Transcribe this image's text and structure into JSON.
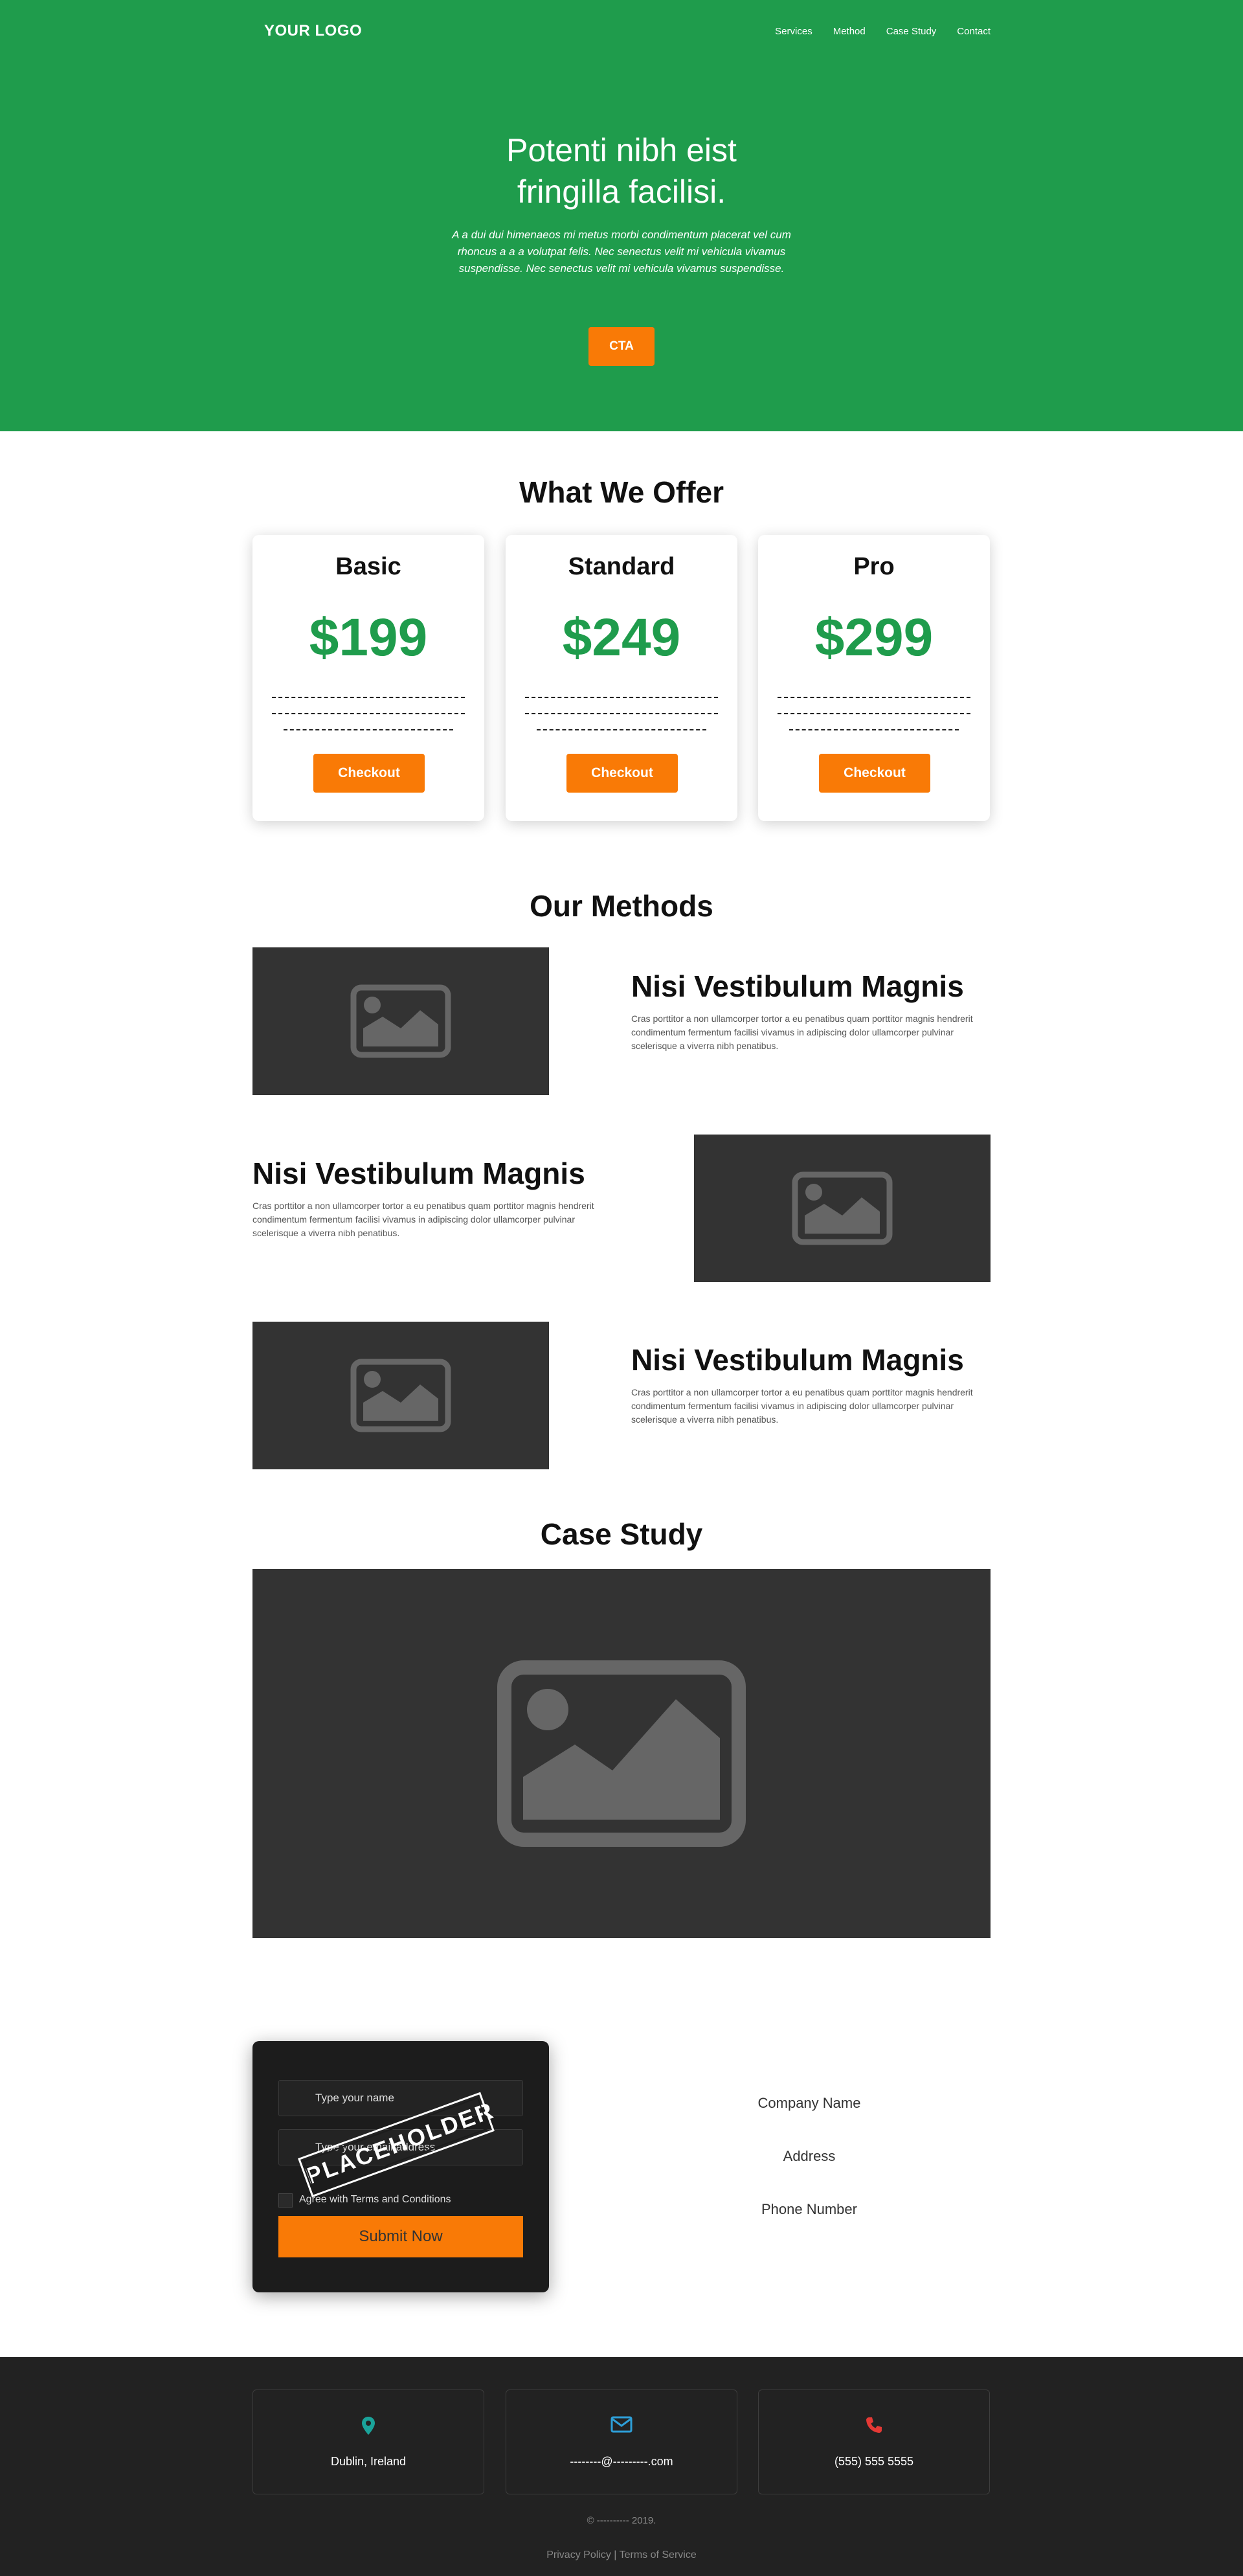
{
  "nav": {
    "logo": "YOUR LOGO",
    "links": [
      "Services",
      "Method",
      "Case Study",
      "Contact"
    ]
  },
  "hero": {
    "title_line1": "Potenti nibh eist",
    "title_line2": "fringilla facilisi.",
    "subtitle": "A a dui dui himenaeos mi metus morbi condimentum placerat vel cum rhoncus a a a volutpat felis. Nec senectus velit mi vehicula vivamus suspendisse. Nec senectus velit mi vehicula vivamus suspendisse.",
    "cta_label": "CTA"
  },
  "offer": {
    "title": "What We Offer",
    "plans": [
      {
        "name": "Basic",
        "price": "$199",
        "button": "Checkout"
      },
      {
        "name": "Standard",
        "price": "$249",
        "button": "Checkout"
      },
      {
        "name": "Pro",
        "price": "$299",
        "button": "Checkout"
      }
    ]
  },
  "methods": {
    "title": "Our Methods",
    "items": [
      {
        "title": "Nisi Vestibulum Magnis",
        "text": "Cras porttitor a non ullamcorper tortor a eu penatibus quam porttitor magnis hendrerit condimentum fermentum facilisi vivamus in adipiscing dolor ullamcorper pulvinar scelerisque a viverra nibh penatibus."
      },
      {
        "title": "Nisi Vestibulum Magnis",
        "text": "Cras porttitor a non ullamcorper tortor a eu penatibus quam porttitor magnis hendrerit condimentum fermentum facilisi vivamus in adipiscing dolor ullamcorper pulvinar scelerisque a viverra nibh penatibus."
      },
      {
        "title": "Nisi Vestibulum Magnis",
        "text": "Cras porttitor a non ullamcorper tortor a eu penatibus quam porttitor magnis hendrerit condimentum fermentum facilisi vivamus in adipiscing dolor ullamcorper pulvinar scelerisque a viverra nibh penatibus."
      }
    ]
  },
  "case_study": {
    "title": "Case Study"
  },
  "contact": {
    "name_placeholder": "Type your name",
    "email_placeholder": "Type your email address",
    "agree_label": "Agree with Terms and Conditions",
    "submit_label": "Submit Now",
    "stamp_text": "PLACEHOLDER",
    "company": "Company Name",
    "address": "Address",
    "phone": "Phone Number"
  },
  "footer": {
    "location": "Dublin, Ireland",
    "email": "--------@---------.com",
    "phone": "(555) 555 5555",
    "copyright": "© ---------- 2019.",
    "legal": "Privacy Policy | Terms of Service"
  },
  "colors": {
    "brand_green": "#1f9c4c",
    "accent_orange": "#f97a06",
    "location_icon": "#1aa39a",
    "email_icon": "#2e9fd8",
    "phone_icon": "#e53935"
  }
}
